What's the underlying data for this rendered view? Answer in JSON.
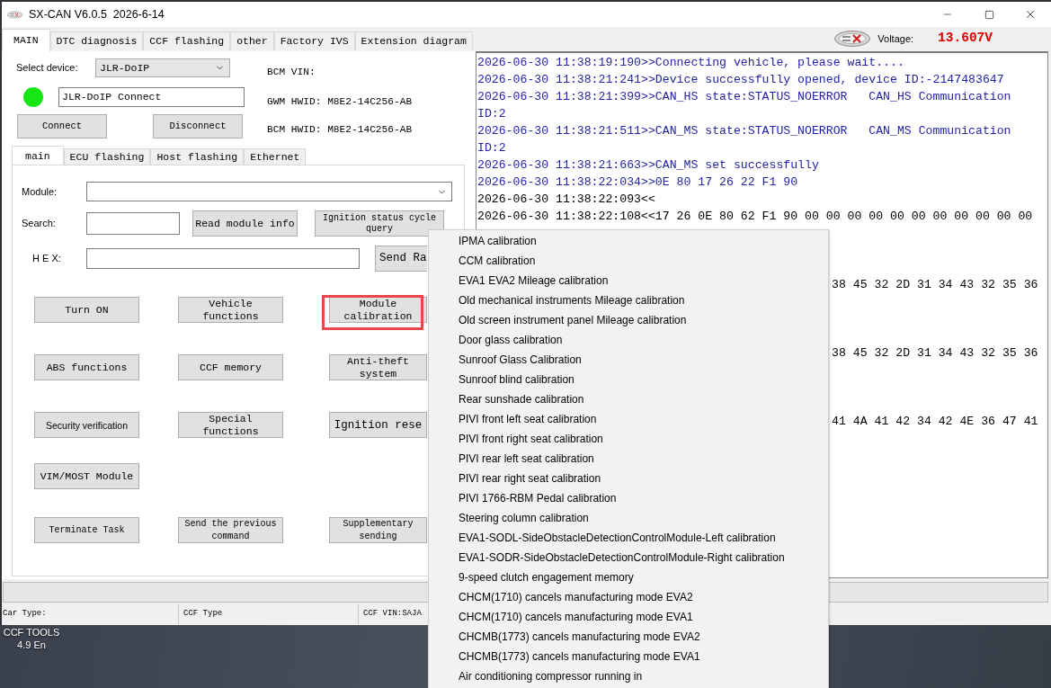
{
  "window": {
    "title": "SX-CAN V6.0.5  2026-6-14"
  },
  "main_tabs": [
    {
      "label": "MAIN",
      "selected": true
    },
    {
      "label": "DTC diagnosis",
      "selected": false
    },
    {
      "label": "CCF flashing",
      "selected": false
    },
    {
      "label": "other",
      "selected": false
    },
    {
      "label": "Factory IVS",
      "selected": false
    },
    {
      "label": "Extension diagram",
      "selected": false
    }
  ],
  "voltage": {
    "label": "Voltage:",
    "value": "13.607V"
  },
  "device": {
    "label": "Select device:",
    "value": "JLR-DoIP",
    "connected": true,
    "connection_text": "JLR-DoIP Connect",
    "connect_button": "Connect",
    "disconnect_button": "Disconnect"
  },
  "vehicle_info": [
    "BCM VIN:",
    "GWM HWID: M8E2-14C256-AB",
    "BCM HWID: M8E2-14C256-AB"
  ],
  "sub_tabs": [
    {
      "label": "main",
      "selected": true
    },
    {
      "label": "ECU flashing",
      "selected": false
    },
    {
      "label": "Host flashing",
      "selected": false
    },
    {
      "label": "Ethernet",
      "selected": false
    }
  ],
  "module": {
    "label": "Module:"
  },
  "search": {
    "label": "Search:",
    "buttons": [
      "Read module info",
      "Ignition status cycle query"
    ]
  },
  "hex": {
    "label": "H E X:",
    "button": "Send Ra"
  },
  "function_buttons": [
    [
      {
        "label": "Turn ON",
        "highlighted": false
      },
      {
        "label": "Vehicle functions",
        "highlighted": false
      },
      {
        "label": "Module calibration",
        "highlighted": true
      }
    ],
    [
      {
        "label": "ABS functions",
        "highlighted": false
      },
      {
        "label": "CCF memory",
        "highlighted": false
      },
      {
        "label": "Anti-theft system",
        "highlighted": false
      }
    ],
    [
      {
        "label": "Security verification",
        "highlighted": false
      },
      {
        "label": "Special functions",
        "highlighted": false
      },
      {
        "label": "Ignition rese",
        "highlighted": false
      }
    ],
    [
      {
        "label": "VIM/MOST Module",
        "highlighted": false
      }
    ],
    [
      {
        "label": "Terminate Task",
        "highlighted": false
      },
      {
        "label": "Send the previous command",
        "highlighted": false
      },
      {
        "label": "Supplementary sending",
        "highlighted": false
      }
    ]
  ],
  "log": {
    "lines": [
      {
        "kind": "sent",
        "text": "2026-06-30 11:38:19:190>>Connecting vehicle, please wait...."
      },
      {
        "kind": "sent",
        "text": "2026-06-30 11:38:21:241>>Device successfully opened, device ID:-2147483647"
      },
      {
        "kind": "sent",
        "text": "2026-06-30 11:38:21:399>>CAN_HS state:STATUS_NOERROR   CAN_HS Communication ID:2"
      },
      {
        "kind": "sent",
        "text": "2026-06-30 11:38:21:511>>CAN_MS state:STATUS_NOERROR   CAN_MS Communication ID:2"
      },
      {
        "kind": "sent",
        "text": "2026-06-30 11:38:21:663>>CAN_MS set successfully"
      },
      {
        "kind": "sent",
        "text": "2026-06-30 11:38:22:034>>0E 80 17 26 22 F1 90"
      },
      {
        "kind": "received",
        "text": "2026-06-30 11:38:22:093<<"
      },
      {
        "kind": "received",
        "text": "2026-06-30 11:38:22:108<<17 26 0E 80 62 F1 90 00 00 00 00 00 00 00 00 00 00 00"
      }
    ],
    "partial_lines": [
      "38 45 32 2D 31 34 43 32 35 36",
      "38 45 32 2D 31 34 43 32 35 36",
      "41 4A 41 42 34 42 4E 36 47 41"
    ]
  },
  "status_bar": [
    "Car Type:",
    "CCF Type",
    "CCF VIN:SAJA"
  ],
  "context_menu": [
    "IPMA calibration",
    "CCM calibration",
    "EVA1 EVA2 Mileage calibration",
    "Old mechanical instruments Mileage calibration",
    "Old screen instrument panel Mileage calibration",
    "Door glass calibration",
    "Sunroof Glass Calibration",
    "Sunroof blind calibration",
    "Rear sunshade calibration",
    "PIVI front left seat calibration",
    "PIVI front right seat calibration",
    "PIVI rear left seat calibration",
    "PIVI rear right seat calibration",
    "PIVI 1766-RBM Pedal calibration",
    "Steering column calibration",
    "EVA1-SODL-SideObstacleDetectionControlModule-Left calibration",
    "EVA1-SODR-SideObstacleDetectionControlModule-Right calibration",
    "9-speed clutch engagement memory",
    "CHCM(1710) cancels manufacturing mode EVA2",
    "CHCM(1710) cancels manufacturing mode EVA1",
    "CHCMB(1773) cancels manufacturing mode EVA2",
    "CHCMB(1773) cancels manufacturing mode EVA1",
    "Air conditioning compressor running in"
  ],
  "desktop_icon": {
    "lines": [
      "CCF TOOLS",
      "4.9 En"
    ]
  }
}
